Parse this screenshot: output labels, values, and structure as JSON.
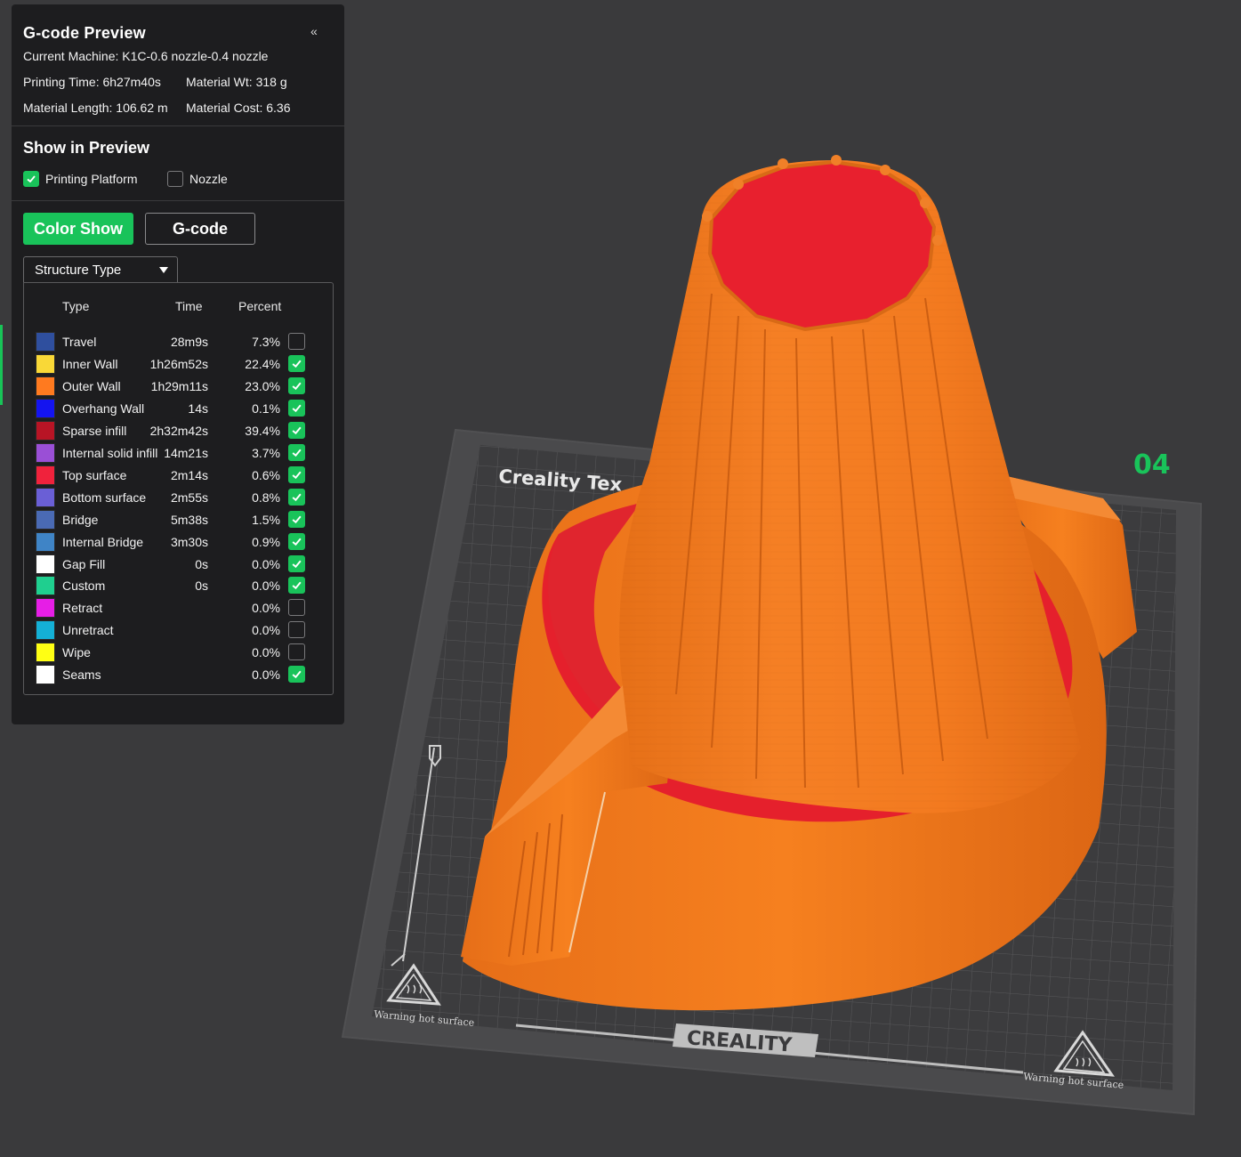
{
  "panel": {
    "title": "G-code Preview",
    "collapse_icon": "«",
    "machine": "Current Machine: K1C-0.6 nozzle-0.4 nozzle",
    "print_time": "Printing Time: 6h27m40s",
    "material_weight": "Material Wt: 318 g",
    "material_length": "Material Length: 106.62 m",
    "material_cost": "Material Cost: 6.36"
  },
  "preview": {
    "title": "Show in Preview",
    "options": [
      {
        "label": "Printing Platform",
        "checked": true
      },
      {
        "label": "Nozzle",
        "checked": false
      }
    ]
  },
  "modes": {
    "color_show": "Color Show",
    "gcode": "G-code"
  },
  "view_dropdown": {
    "selected": "Structure Type"
  },
  "legend": {
    "headers": {
      "type": "Type",
      "time": "Time",
      "percent": "Percent"
    },
    "rows": [
      {
        "type": "Travel",
        "time": "28m9s",
        "percent": "7.3%",
        "color": "#2f4f9e",
        "checked": false
      },
      {
        "type": "Inner Wall",
        "time": "1h26m52s",
        "percent": "22.4%",
        "color": "#f9d837",
        "checked": true
      },
      {
        "type": "Outer Wall",
        "time": "1h29m11s",
        "percent": "23.0%",
        "color": "#ff7a1f",
        "checked": true
      },
      {
        "type": "Overhang Wall",
        "time": "14s",
        "percent": "0.1%",
        "color": "#1414f0",
        "checked": true
      },
      {
        "type": "Sparse infill",
        "time": "2h32m42s",
        "percent": "39.4%",
        "color": "#b81425",
        "checked": true
      },
      {
        "type": "Internal solid infill",
        "time": "14m21s",
        "percent": "3.7%",
        "color": "#9a4fd6",
        "checked": true
      },
      {
        "type": "Top surface",
        "time": "2m14s",
        "percent": "0.6%",
        "color": "#f0223c",
        "checked": true
      },
      {
        "type": "Bottom surface",
        "time": "2m55s",
        "percent": "0.8%",
        "color": "#6a5fd6",
        "checked": true
      },
      {
        "type": "Bridge",
        "time": "5m38s",
        "percent": "1.5%",
        "color": "#4a6ab4",
        "checked": true
      },
      {
        "type": "Internal Bridge",
        "time": "3m30s",
        "percent": "0.9%",
        "color": "#3f84c6",
        "checked": true
      },
      {
        "type": "Gap Fill",
        "time": "0s",
        "percent": "0.0%",
        "color": "#ffffff",
        "checked": true
      },
      {
        "type": "Custom",
        "time": "0s",
        "percent": "0.0%",
        "color": "#1fcf8f",
        "checked": true
      },
      {
        "type": "Retract",
        "time": "",
        "percent": "0.0%",
        "color": "#e61ee6",
        "checked": false
      },
      {
        "type": "Unretract",
        "time": "",
        "percent": "0.0%",
        "color": "#14b0d6",
        "checked": false
      },
      {
        "type": "Wipe",
        "time": "",
        "percent": "0.0%",
        "color": "#ffff14",
        "checked": false
      },
      {
        "type": "Seams",
        "time": "",
        "percent": "0.0%",
        "color": "#ffffff",
        "checked": true
      }
    ]
  },
  "plate": {
    "texture_label": "Creality Tex",
    "number": "04",
    "brand": "CREALITY",
    "warning_left": "Warning hot surface",
    "warning_right": "Warning hot surface"
  },
  "colors": {
    "accent": "#19c35a",
    "outer_wall": "#ff7a1f",
    "top_surface": "#e8202e",
    "background": "#3a3a3c",
    "panel": "#1d1d1f"
  }
}
